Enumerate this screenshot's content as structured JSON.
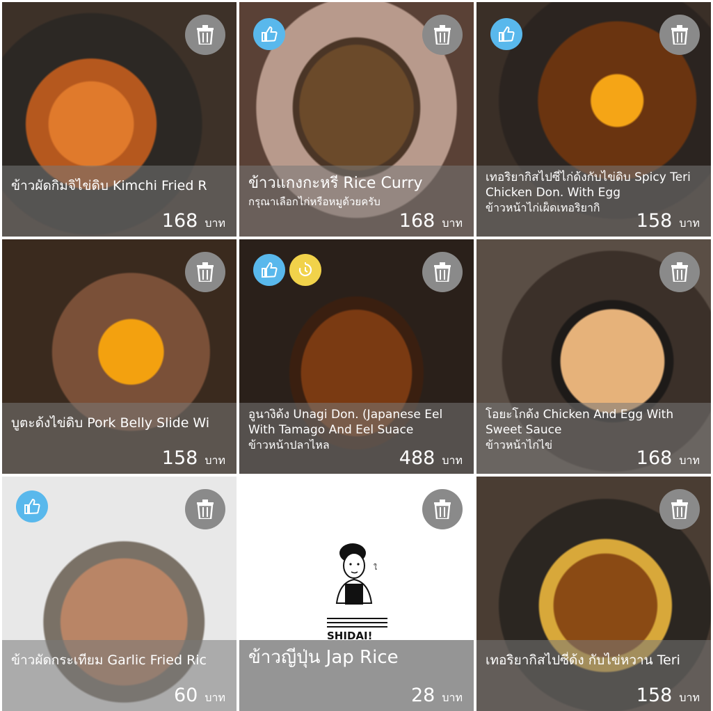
{
  "currency": "บาท",
  "items": [
    {
      "name": "ข้าวผัดกิมจิไข่ดิบ Kimchi Fried R",
      "subtitle": "",
      "price": "168",
      "liked": false,
      "timer": false
    },
    {
      "name": "ข้าวแกงกะหรี่ Rice Curry",
      "subtitle": "กรุณาเลือกไก่หรือหมูด้วยครับ",
      "price": "168",
      "liked": true,
      "timer": false
    },
    {
      "name": "เทอริยากิสไปซี่ไก่ด้งกับไข่ดิบ Spicy Teri Chicken Don. With Egg",
      "subtitle": "ข้าวหน้าไก่เผ็ดเทอริยากิ",
      "price": "158",
      "liked": true,
      "timer": false
    },
    {
      "name": "บูตะด้งไข่ดิบ Pork Belly Slide Wi",
      "subtitle": "",
      "price": "158",
      "liked": false,
      "timer": false
    },
    {
      "name": "อูนางิด้ง Unagi Don. (Japanese Eel With Tamago And Eel Suace",
      "subtitle": "ข้าวหน้าปลาไหล",
      "price": "488",
      "liked": true,
      "timer": true
    },
    {
      "name": "โอยะโกด้ง Chicken And Egg With Sweet Sauce",
      "subtitle": "ข้าวหน้าไก่ไข่",
      "price": "168",
      "liked": false,
      "timer": false
    },
    {
      "name": "ข้าวผัดกระเทียม Garlic Fried Ric",
      "subtitle": "",
      "price": "60",
      "liked": true,
      "timer": false
    },
    {
      "name": "ข้าวญี่ปุ่น Jap Rice",
      "subtitle": "",
      "price": "28",
      "liked": false,
      "timer": false
    },
    {
      "name": "เทอริยากิสไปซี่ด้ง กับไข่หวาน Teri",
      "subtitle": "",
      "price": "158",
      "liked": false,
      "timer": false
    }
  ],
  "logo": {
    "text": "SHIDAI!",
    "mark": "ใ"
  },
  "colors": {
    "like": "#59b8ec",
    "timer": "#f1d24a",
    "trash": "#8a8a8a"
  }
}
